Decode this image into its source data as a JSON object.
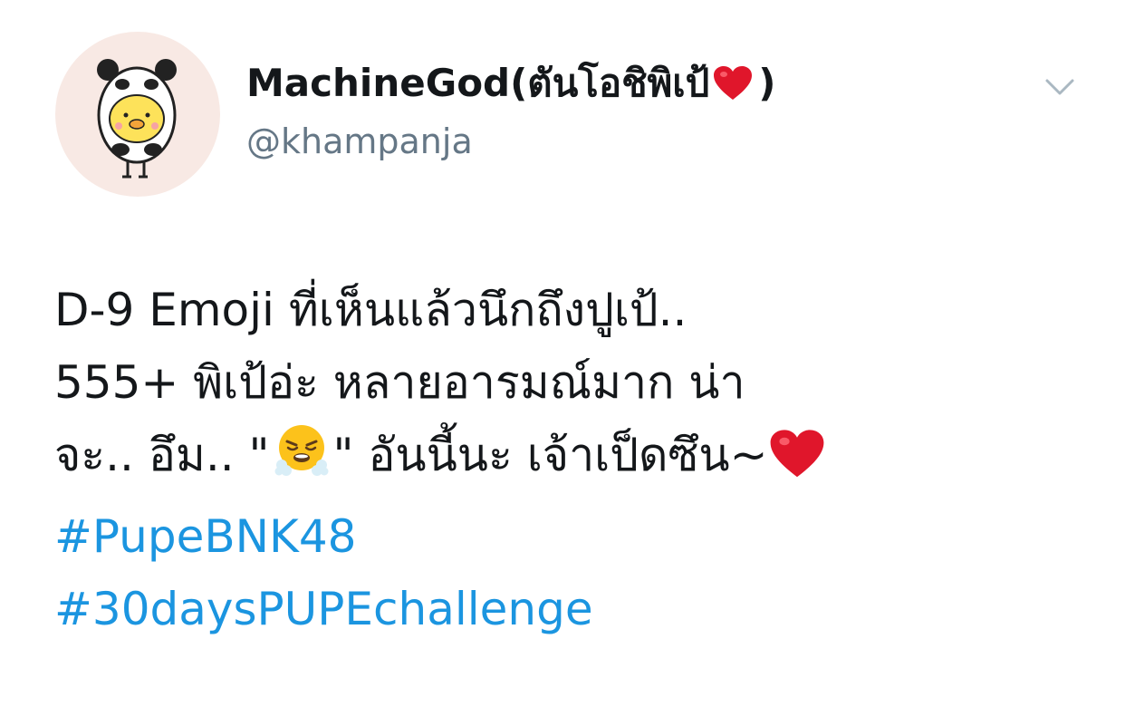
{
  "tweet": {
    "author": {
      "display_name": "MachineGod(ตันโอชิพิเป้",
      "display_name_close": ")",
      "handle": "@khampanja",
      "avatar_icon": "duck-in-panda-costume-avatar",
      "verified_heart_icon": "red-heart-emoji"
    },
    "menu_icon": "chevron-down-icon",
    "body": {
      "line1": "D-9 Emoji ที่เห็นแล้วนึกถึงปูเป้..",
      "line2": "555+ พิเป้อ่ะ หลายอารมณ์มาก น่า",
      "line3_a": "จะ.. อึม.. \"",
      "line3_emoji": "face-with-steam-from-nose-emoji",
      "line3_b": "\" อันนี้นะ เจ้าเป็ดซึน~",
      "line3_end_emoji": "red-heart-emoji"
    },
    "hashtags": [
      "#PupeBNK48",
      "#30daysPUPEchallenge"
    ]
  },
  "colors": {
    "text": "#14171a",
    "secondary_text": "#657786",
    "link": "#1b95e0",
    "heart": "#e0162b"
  }
}
